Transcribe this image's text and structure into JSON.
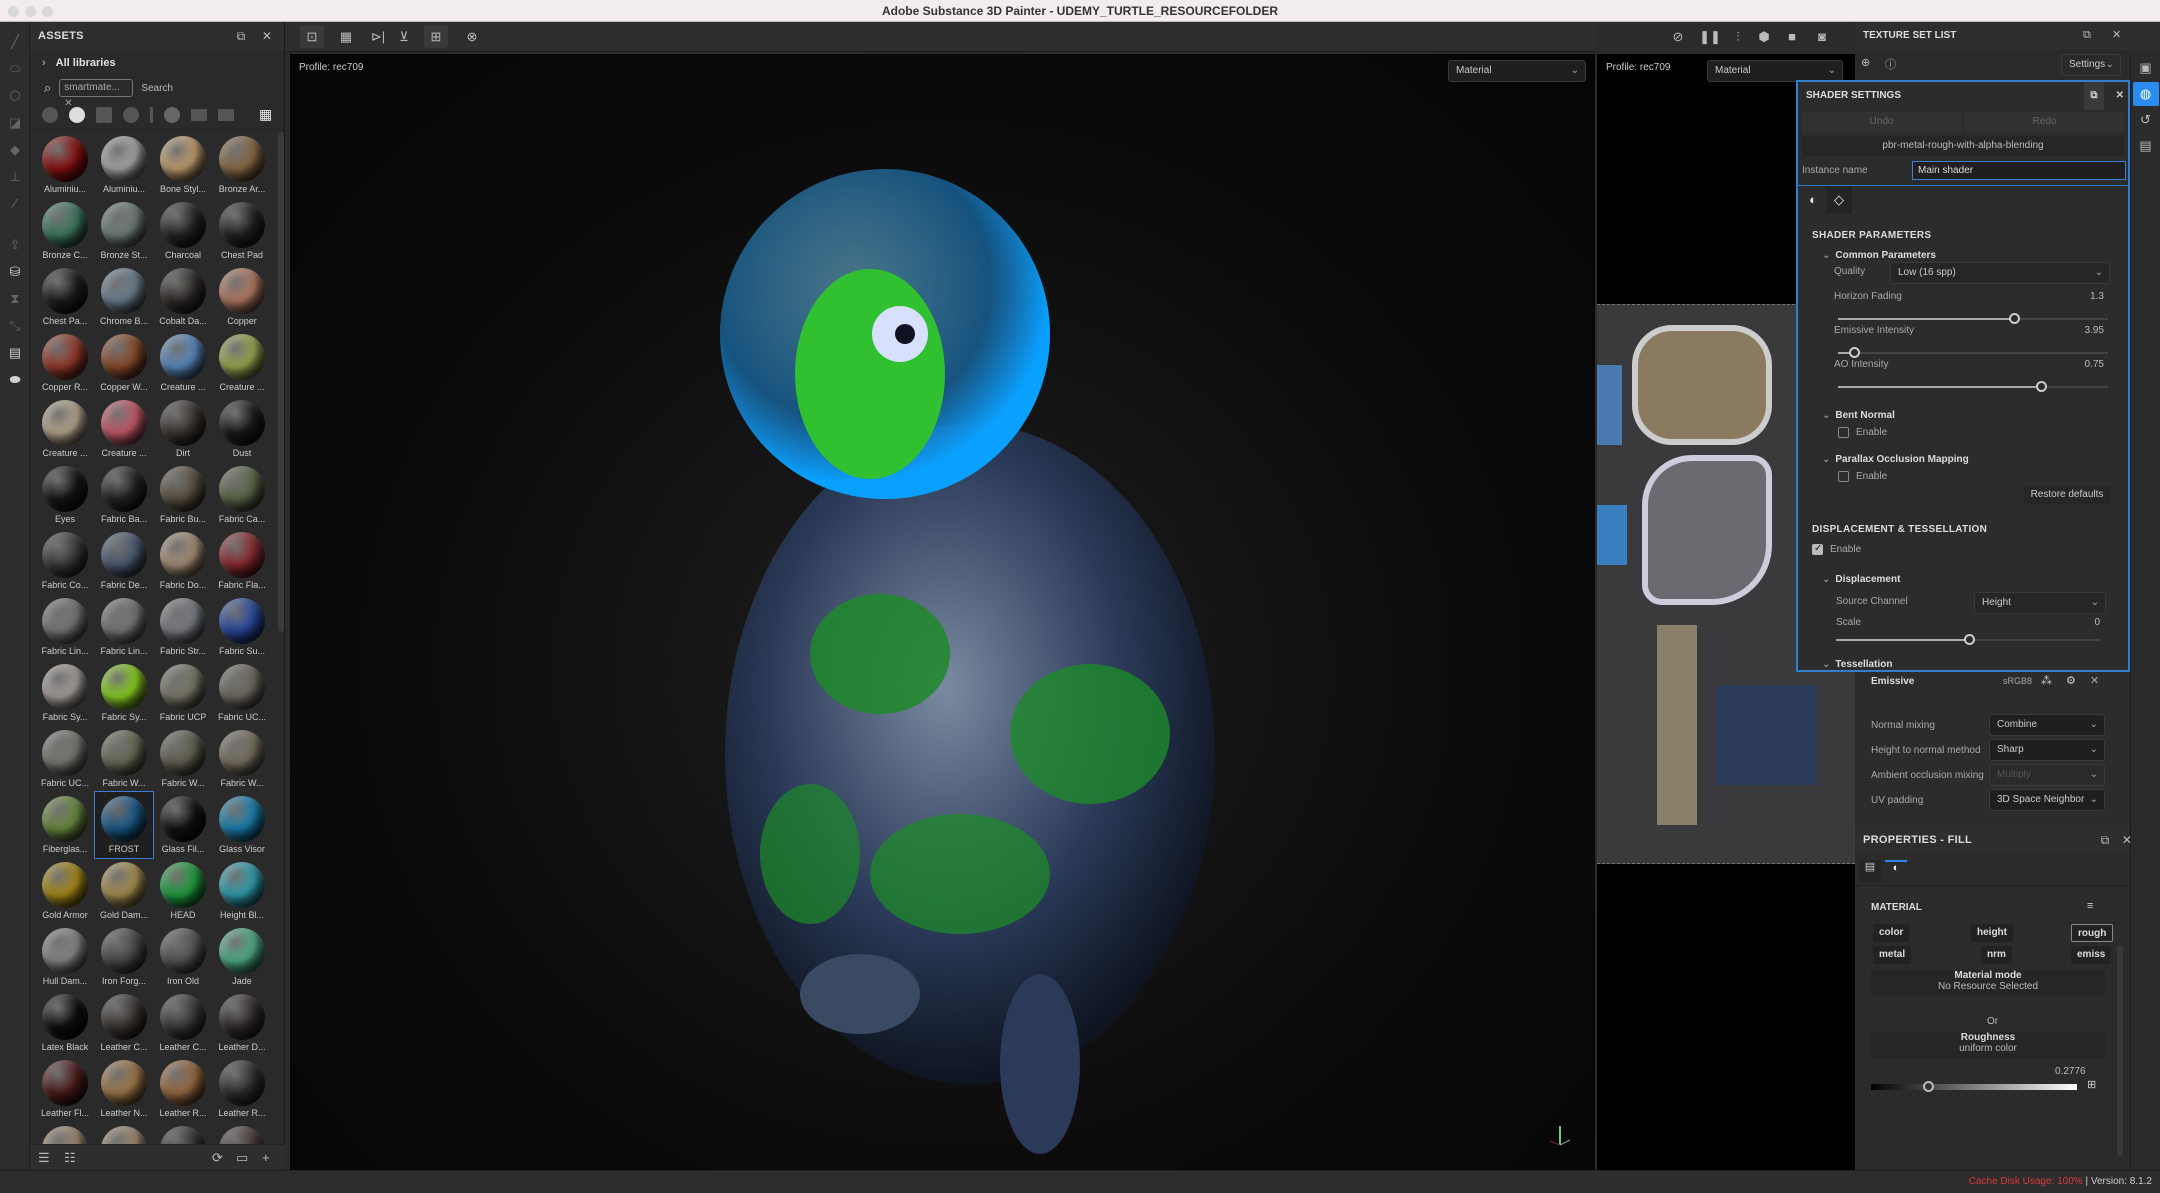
{
  "app": {
    "title": "Adobe Substance 3D Painter - UDEMY_TURTLE_RESOURCEFOLDER"
  },
  "assets": {
    "title": "ASSETS",
    "library": "All libraries",
    "search_chip": "smartmate...",
    "search_placeholder": "Search",
    "items": [
      {
        "name": "Aluminiu...",
        "color": "#8a1010"
      },
      {
        "name": "Aluminiu...",
        "color": "#a8a8a8"
      },
      {
        "name": "Bone Styl...",
        "color": "#c4a070"
      },
      {
        "name": "Bronze Ar...",
        "color": "#8a6a45"
      },
      {
        "name": "Bronze C...",
        "color": "#3f7a60"
      },
      {
        "name": "Bronze St...",
        "color": "#6f7f7a"
      },
      {
        "name": "Charcoal",
        "color": "#262626"
      },
      {
        "name": "Chest Pad",
        "color": "#222"
      },
      {
        "name": "Chest Pa...",
        "color": "#1d1d1d"
      },
      {
        "name": "Chrome B...",
        "color": "#6c7f90"
      },
      {
        "name": "Cobalt Da...",
        "color": "#2f2b28"
      },
      {
        "name": "Copper",
        "color": "#b47a62"
      },
      {
        "name": "Copper R...",
        "color": "#953a2a"
      },
      {
        "name": "Copper W...",
        "color": "#8a4a28"
      },
      {
        "name": "Creature ...",
        "color": "#5a8ac0"
      },
      {
        "name": "Creature ...",
        "color": "#9aa850"
      },
      {
        "name": "Creature ...",
        "color": "#b8a890"
      },
      {
        "name": "Creature ...",
        "color": "#c85a6a"
      },
      {
        "name": "Dirt",
        "color": "#3a3430"
      },
      {
        "name": "Dust",
        "color": "#1a1a1a"
      },
      {
        "name": "Eyes",
        "color": "#151515"
      },
      {
        "name": "Fabric Ba...",
        "color": "#222"
      },
      {
        "name": "Fabric Bu...",
        "color": "#5a5040"
      },
      {
        "name": "Fabric Ca...",
        "color": "#5a6848"
      },
      {
        "name": "Fabric Co...",
        "color": "#3a3a3a"
      },
      {
        "name": "Fabric De...",
        "color": "#4a5a70"
      },
      {
        "name": "Fabric Do...",
        "color": "#a89078"
      },
      {
        "name": "Fabric Fla...",
        "color": "#8a2a30"
      },
      {
        "name": "Fabric Lin...",
        "color": "#777"
      },
      {
        "name": "Fabric Lin...",
        "color": "#777"
      },
      {
        "name": "Fabric Str...",
        "color": "#7a7e84"
      },
      {
        "name": "Fabric Su...",
        "color": "#2a4aa0"
      },
      {
        "name": "Fabric Sy...",
        "color": "#a8a09a"
      },
      {
        "name": "Fabric Sy...",
        "color": "#8ad020"
      },
      {
        "name": "Fabric UCP",
        "color": "#7a7868"
      },
      {
        "name": "Fabric UC...",
        "color": "#6e6a60"
      },
      {
        "name": "Fabric UC...",
        "color": "#7a7870"
      },
      {
        "name": "Fabric W...",
        "color": "#6a6a58"
      },
      {
        "name": "Fabric W...",
        "color": "#626050"
      },
      {
        "name": "Fabric W...",
        "color": "#787060"
      },
      {
        "name": "Fiberglas...",
        "color": "#6a8a40"
      },
      {
        "name": "FROST",
        "color": "#1a5a8a",
        "selected": true
      },
      {
        "name": "Glass Fil...",
        "color": "#111"
      },
      {
        "name": "Glass Visor",
        "color": "#1a80b0"
      },
      {
        "name": "Gold Armor",
        "color": "#a88a18"
      },
      {
        "name": "Gold Dam...",
        "color": "#a89050"
      },
      {
        "name": "HEAD",
        "color": "#20a040"
      },
      {
        "name": "Height Bl...",
        "color": "#30a0b0"
      },
      {
        "name": "Hull Dam...",
        "color": "#888"
      },
      {
        "name": "Iron Forg...",
        "color": "#4a4a4a"
      },
      {
        "name": "Iron Old",
        "color": "#555"
      },
      {
        "name": "Jade",
        "color": "#50b088"
      },
      {
        "name": "Latex Black",
        "color": "#0e0e0e"
      },
      {
        "name": "Leather C...",
        "color": "#3a3430"
      },
      {
        "name": "Leather C...",
        "color": "#3a3a3a"
      },
      {
        "name": "Leather D...",
        "color": "#322c2a"
      },
      {
        "name": "Leather Fl...",
        "color": "#4a1a18"
      },
      {
        "name": "Leather N...",
        "color": "#a07848"
      },
      {
        "name": "Leather R...",
        "color": "#9a6a40"
      },
      {
        "name": "Leather R...",
        "color": "#2e2e2e"
      },
      {
        "name": "",
        "color": "#a08a70"
      },
      {
        "name": "",
        "color": "#a08a70"
      },
      {
        "name": "",
        "color": "#333"
      },
      {
        "name": "",
        "color": "#4a3a38"
      }
    ]
  },
  "viewport": {
    "profile_3d": "Profile: rec709",
    "mode_3d": "Material",
    "profile_2d": "Profile: rec709",
    "mode_2d": "Material"
  },
  "texture_set_list": {
    "title": "TEXTURE SET LIST",
    "settings": "Settings"
  },
  "shader_settings": {
    "title": "SHADER SETTINGS",
    "undo": "Undo",
    "redo": "Redo",
    "shader_name": "pbr-metal-rough-with-alpha-blending",
    "instance_label": "Instance name",
    "instance_value": "Main shader",
    "section_params": "SHADER PARAMETERS",
    "common": "Common Parameters",
    "quality_label": "Quality",
    "quality_value": "Low (16 spp)",
    "horizon_label": "Horizon Fading",
    "horizon_value": "1.3",
    "horizon_fraction": 0.65,
    "emissive_label": "Emissive Intensity",
    "emissive_value": "3.95",
    "emissive_fraction": 0.06,
    "ao_label": "AO Intensity",
    "ao_value": "0.75",
    "ao_fraction": 0.75,
    "bent_normal": "Bent Normal",
    "bent_enable": "Enable",
    "bent_checked": false,
    "pom": "Parallax Occlusion Mapping",
    "pom_enable": "Enable",
    "pom_checked": false,
    "restore": "Restore defaults",
    "section_disp": "DISPLACEMENT & TESSELLATION",
    "disp_enable": "Enable",
    "disp_checked": true,
    "displacement": "Displacement",
    "source_label": "Source Channel",
    "source_value": "Height",
    "scale_label": "Scale",
    "scale_value": "0",
    "scale_fraction": 0.5,
    "tessellation": "Tessellation"
  },
  "texture_settings": {
    "emissive_label": "Emissive",
    "emissive_format": "sRGB8",
    "normal_mixing_label": "Normal mixing",
    "normal_mixing_value": "Combine",
    "height_normal_label": "Height to normal method",
    "height_normal_value": "Sharp",
    "ao_mixing_label": "Ambient occlusion mixing",
    "ao_mixing_value": "Multiply",
    "uv_padding_label": "UV padding",
    "uv_padding_value": "3D Space Neighbor"
  },
  "properties": {
    "title": "PROPERTIES - FILL",
    "material_label": "MATERIAL",
    "channels": [
      "color",
      "height",
      "rough",
      "metal",
      "nrm",
      "emiss"
    ],
    "material_mode": "Material mode",
    "no_resource": "No Resource Selected",
    "or": "Or",
    "roughness": "Roughness",
    "uniform": "uniform color",
    "roughness_value": "0.2776",
    "roughness_fraction": 0.2776
  },
  "status": {
    "cache_label": "Cache Disk Usage:",
    "cache_value": "100%",
    "version": "| Version: 8.1.2"
  }
}
